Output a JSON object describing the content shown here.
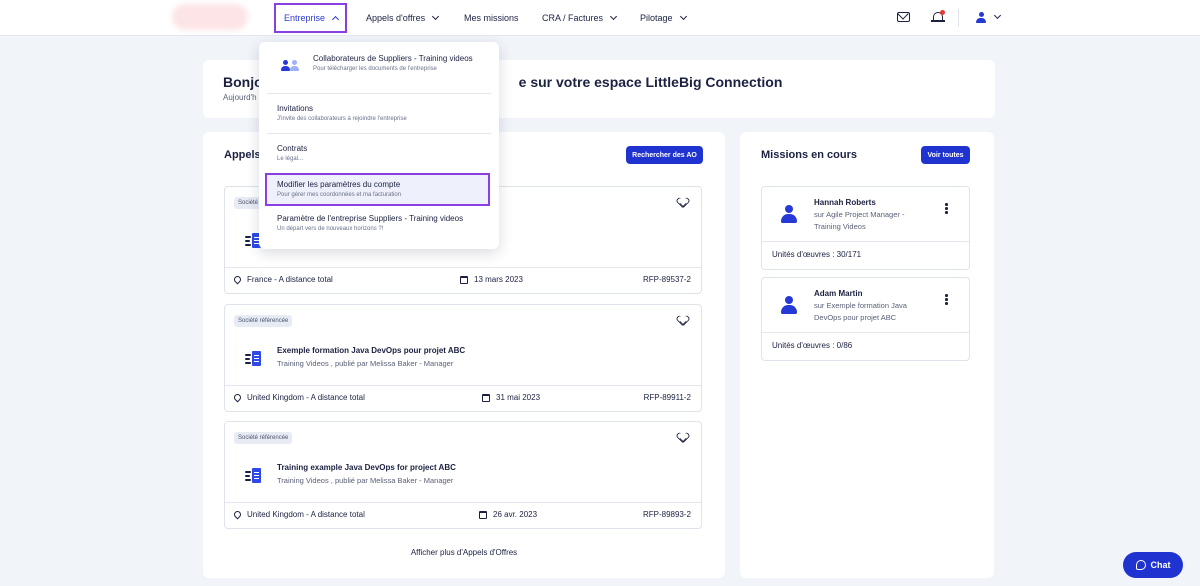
{
  "nav": {
    "items": [
      {
        "label": "Entreprise"
      },
      {
        "label": "Appels d'offres"
      },
      {
        "label": "Mes missions"
      },
      {
        "label": "CRA / Factures"
      },
      {
        "label": "Pilotage"
      }
    ]
  },
  "welcome": {
    "title_left": "Bonjo",
    "title_right": "e sur votre espace LittleBig Connection",
    "subtitle": "Aujourd'h"
  },
  "dropdown": {
    "items": [
      {
        "title": "Collaborateurs de Suppliers - Training videos",
        "subtitle": "Pour télécharger les documents de l'entreprise"
      },
      {
        "title": "Invitations",
        "subtitle": "J'invite des collaborateurs à rejoindre l'entreprise"
      },
      {
        "title": "Contrats",
        "subtitle": "Le légal..."
      },
      {
        "title": "Modifier les paramètres du compte",
        "subtitle": "Pour gérer mes coordonnées et ma facturation"
      },
      {
        "title": "Paramètre de l'entreprise Suppliers - Training videos",
        "subtitle": "Un départ vers de nouveaux horizons ?!"
      }
    ]
  },
  "ao": {
    "title": "Appels",
    "search_button": "Rechercher des AO",
    "badge": "Société référencée",
    "cards": [
      {
        "badge": "Société",
        "title": "",
        "subtitle": "",
        "location": "France - A distance total",
        "date": "13 mars 2023",
        "ref": "RFP-89537-2"
      },
      {
        "badge": "Société référencée",
        "title": "Exemple formation Java DevOps pour projet ABC",
        "subtitle": "Training Videos , publié par Melissa Baker - Manager",
        "location": "United Kingdom - A distance total",
        "date": "31 mai 2023",
        "ref": "RFP-89911-2"
      },
      {
        "badge": "Société référencée",
        "title": "Training example Java DevOps for project ABC",
        "subtitle": "Training Videos , publié par Melissa Baker - Manager",
        "location": "United Kingdom - A distance total",
        "date": "26 avr. 2023",
        "ref": "RFP-89893-2"
      }
    ],
    "show_more": "Afficher plus d'Appels d'Offres"
  },
  "missions": {
    "title": "Missions en cours",
    "see_all": "Voir toutes",
    "items": [
      {
        "name": "Hannah Roberts",
        "role": "sur Agile Project Manager - Training Videos",
        "units": "Unités d'œuvres : 30/171"
      },
      {
        "name": "Adam Martin",
        "role": "sur Exemple formation Java DevOps pour projet ABC",
        "units": "Unités d'œuvres : 0/86"
      }
    ]
  },
  "chat": {
    "label": "Chat"
  },
  "colors": {
    "accent": "#1f33d0",
    "highlight_border": "#8b3fe0",
    "notification_dot": "#e53935"
  }
}
